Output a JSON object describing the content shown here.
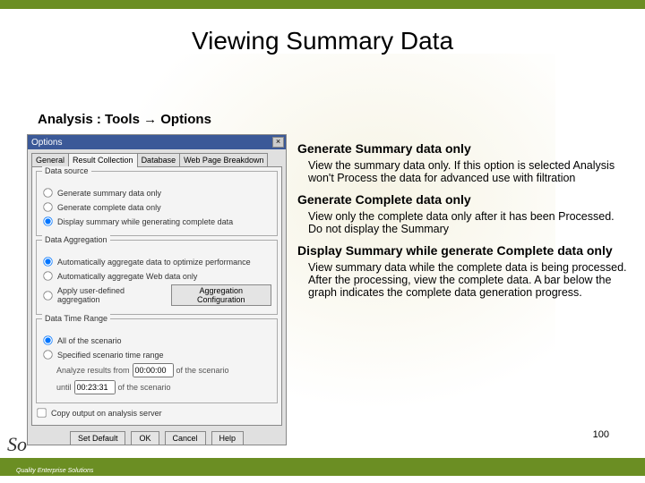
{
  "slide": {
    "title": "Viewing Summary Data",
    "breadcrumb": "Analysis : Tools → Options",
    "page_number": "100"
  },
  "dialog": {
    "title": "Options",
    "close": "×",
    "tabs": {
      "general": "General",
      "result": "Result Collection",
      "database": "Database",
      "web": "Web Page Breakdown"
    },
    "group_datasource": {
      "title": "Data source",
      "opt1": "Generate summary data only",
      "opt2": "Generate complete data only",
      "opt3": "Display summary while generating complete data"
    },
    "group_aggreg": {
      "title": "Data Aggregation",
      "opt1": "Automatically aggregate data to optimize performance",
      "opt2": "Automatically aggregate Web data only",
      "opt3": "Apply user-defined aggregation",
      "btn": "Aggregation Configuration"
    },
    "group_timerange": {
      "title": "Data Time Range",
      "opt1": "All of the scenario",
      "opt2": "Specified scenario time range",
      "from_label": "Analyze results from",
      "from_val": "00:00:00",
      "from_suffix": "of the scenario",
      "until_label": "until",
      "until_val": "00:23:31",
      "until_suffix": "of the scenario"
    },
    "copy_label": "Copy output on analysis server",
    "buttons": {
      "setdefault": "Set Default",
      "ok": "OK",
      "cancel": "Cancel",
      "help": "Help"
    }
  },
  "explain": {
    "h1": "Generate Summary data only",
    "p1": "View the summary data only. If this option is selected Analysis won't Process the data for advanced use with filtration",
    "h2": "Generate Complete data only",
    "p2": "View only the complete data only after it has been Processed. Do not display the Summary",
    "h3": "Display Summary while generate Complete data only",
    "p3": "View summary data while the complete data is being processed. After the processing, view the complete data. A bar below the graph indicates the complete data generation progress."
  },
  "logo": {
    "text": "So",
    "sub": "Quality Enterprise Solutions"
  }
}
